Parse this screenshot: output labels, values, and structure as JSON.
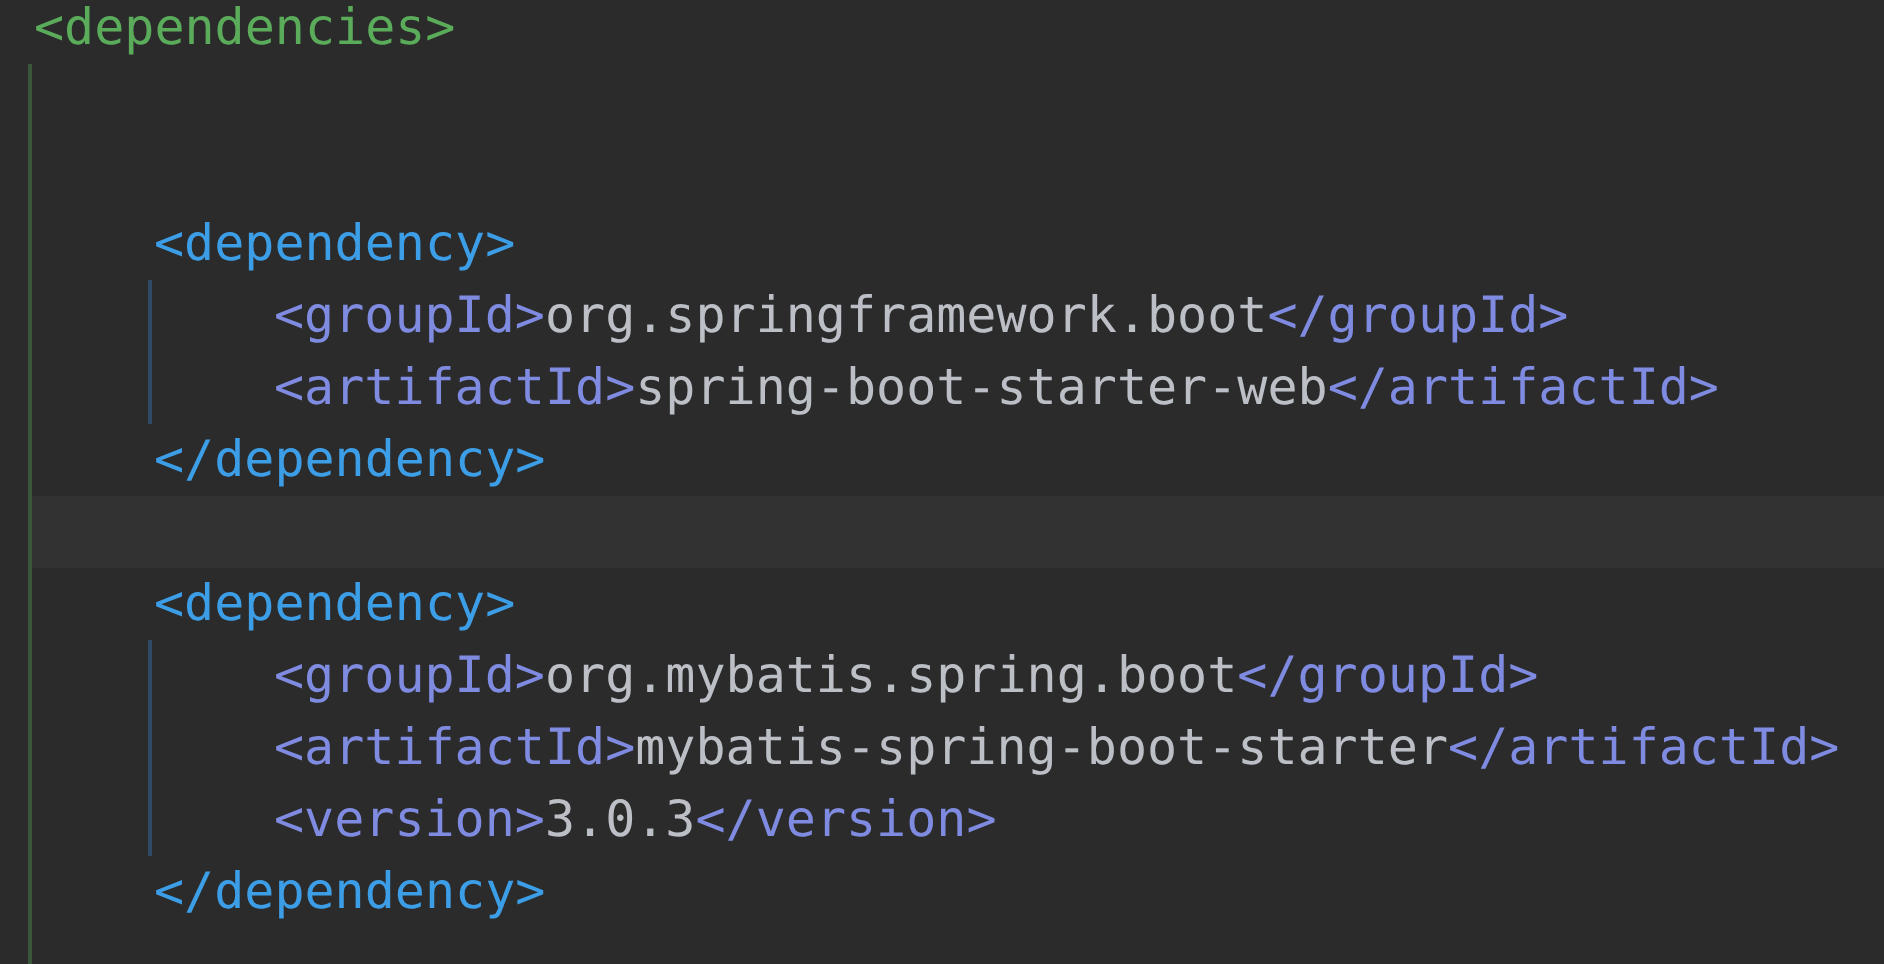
{
  "document": {
    "open": "<dependencies>",
    "children": [
      {
        "kind": "blank"
      },
      {
        "kind": "blank"
      },
      {
        "kind": "element",
        "open": "<dependency>",
        "close": "</dependency>",
        "children": [
          {
            "tag_open": "<groupId>",
            "value": "org.springframework.boot",
            "tag_close": "</groupId>"
          },
          {
            "tag_open": "<artifactId>",
            "value": "spring-boot-starter-web",
            "tag_close": "</artifactId>"
          }
        ]
      },
      {
        "kind": "current_line"
      },
      {
        "kind": "element",
        "open": "<dependency>",
        "close": "</dependency>",
        "children": [
          {
            "tag_open": "<groupId>",
            "value": "org.mybatis.spring.boot",
            "tag_close": "</groupId>"
          },
          {
            "tag_open": "<artifactId>",
            "value": "mybatis-spring-boot-starter",
            "tag_close": "</artifactId>"
          },
          {
            "tag_open": "<version>",
            "value": "3.0.3",
            "tag_close": "</version>"
          }
        ]
      }
    ]
  }
}
